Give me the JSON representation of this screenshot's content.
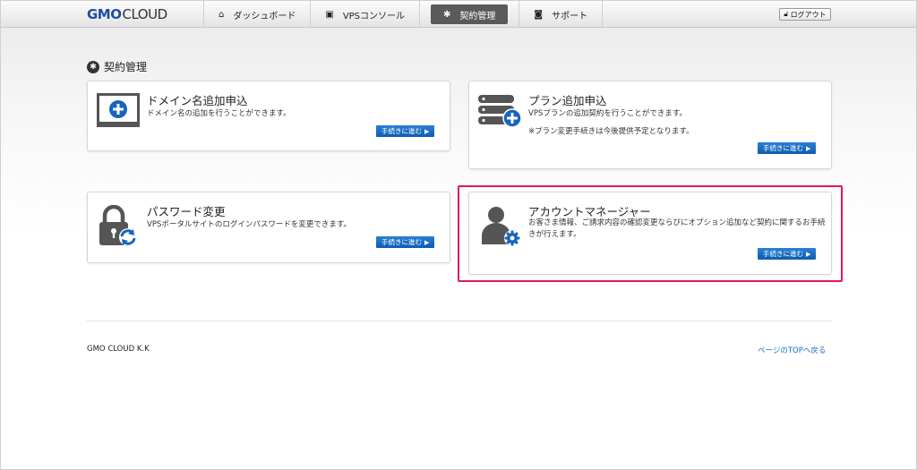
{
  "header": {
    "logo_gmo": "GMO",
    "logo_cloud": "CLOUD",
    "nav": [
      {
        "label": "ダッシュボード",
        "icon": "home-icon"
      },
      {
        "label": "VPSコンソール",
        "icon": "console-icon"
      },
      {
        "label": "契約管理",
        "icon": "gear-icon",
        "active": true
      },
      {
        "label": "サポート",
        "icon": "camera-icon"
      }
    ],
    "logout_label": "ログアウト"
  },
  "section": {
    "title": "契約管理"
  },
  "cards": [
    {
      "title": "ドメイン名追加申込",
      "description": "ドメイン名の追加を行うことができます。",
      "note": "",
      "button": "手続きに進む",
      "icon": "domain-add-icon"
    },
    {
      "title": "プラン追加申込",
      "description": "VPSプランの追加契約を行うことができます。",
      "note": "※プラン変更手続きは今後提供予定となります。",
      "button": "手続きに進む",
      "icon": "server-add-icon"
    },
    {
      "title": "パスワード変更",
      "description": "VPSポータルサイトのログインパスワードを変更できます。",
      "note": "",
      "button": "手続きに進む",
      "icon": "lock-refresh-icon"
    },
    {
      "title": "アカウントマネージャー",
      "description": "お客さま情報、ご請求内容の確認変更ならびにオプション追加など契約に関するお手続きが行えます。",
      "note": "",
      "button": "手続きに進む",
      "icon": "user-gear-icon"
    }
  ],
  "footer": {
    "company": "GMO CLOUD K.K",
    "back_to_top": "ページのTOPへ戻る"
  },
  "colors": {
    "accent_blue": "#1565c0",
    "logo_blue": "#1d4f9f",
    "highlight": "#e0195c"
  }
}
